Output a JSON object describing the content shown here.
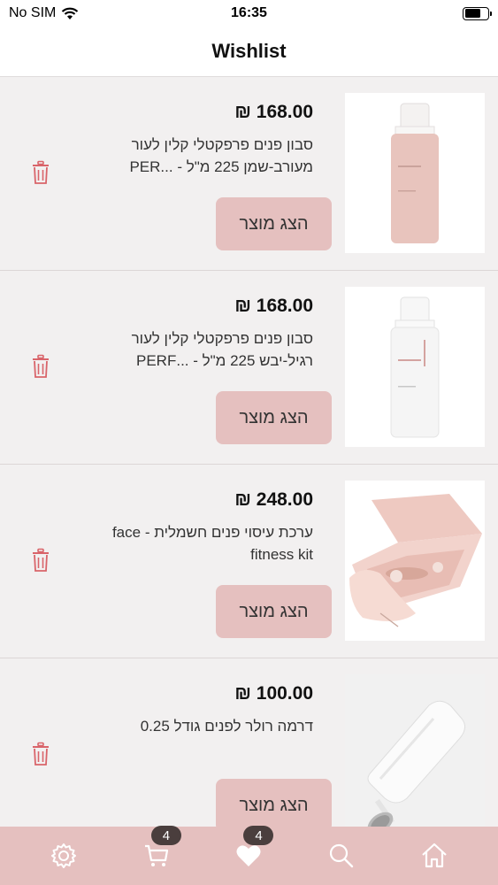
{
  "status_bar": {
    "carrier": "No SIM",
    "time": "16:35"
  },
  "header": {
    "title": "Wishlist"
  },
  "items": [
    {
      "price": "₪ 168.00",
      "name": "סבון פנים פרפקטלי קלין לעור מעורב-שמן 225 מ\"ל - ...PER",
      "button": "הצג מוצר",
      "image": "pink-foam-bottle"
    },
    {
      "price": "₪ 168.00",
      "name": "סבון פנים פרפקטלי קלין לעור רגיל-יבש 225 מ\"ל - ...PERF",
      "button": "הצג מוצר",
      "image": "white-foam-bottle"
    },
    {
      "price": "₪ 248.00",
      "name": "ערכת עיסוי פנים חשמלית - face fitness kit",
      "button": "הצג מוצר",
      "image": "face-fitness-kit-box"
    },
    {
      "price": "₪ 100.00",
      "name": "דרמה רולר לפנים גודל 0.25",
      "button": "הצג מוצר",
      "image": "derma-roller"
    }
  ],
  "tabbar": {
    "cart_badge": "4",
    "wishlist_badge": "4",
    "icons": [
      "gear-icon",
      "cart-icon",
      "heart-icon",
      "search-icon",
      "home-icon"
    ]
  },
  "colors": {
    "accent": "#e5c0bf",
    "badge": "#4a3e3d",
    "trash": "#d9646a"
  }
}
